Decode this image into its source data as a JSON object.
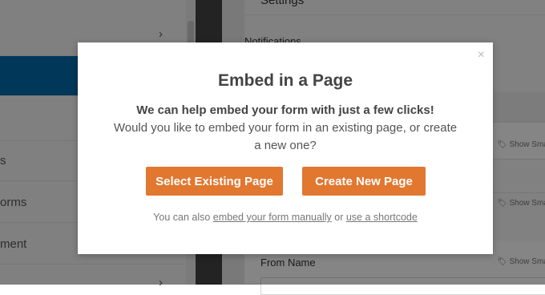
{
  "background": {
    "header_title": "Settings",
    "sidebar_items": [
      {
        "label": "",
        "has_chevron": true
      },
      {
        "label": ""
      },
      {
        "label": ""
      },
      {
        "label": "s"
      },
      {
        "label": "orms"
      },
      {
        "label": "ment"
      }
    ],
    "panel": {
      "notifications_label": "Notifications",
      "show_smart_label": "Show Sma",
      "from_name_label": "From Name"
    }
  },
  "modal": {
    "title": "Embed in a Page",
    "desc_line1": "We can help embed your form with just a few clicks!",
    "desc_line2": "Would you like to embed your form in an existing page, or create a new one?",
    "select_button": "Select Existing Page",
    "create_button": "Create New Page",
    "footer_prefix": "You can also",
    "footer_link1": "embed your form manually",
    "footer_middle": "or",
    "footer_link2": "use a shortcode",
    "close_glyph": "×"
  },
  "colors": {
    "accent": "#e27730",
    "sidebar_active": "#036aab"
  }
}
